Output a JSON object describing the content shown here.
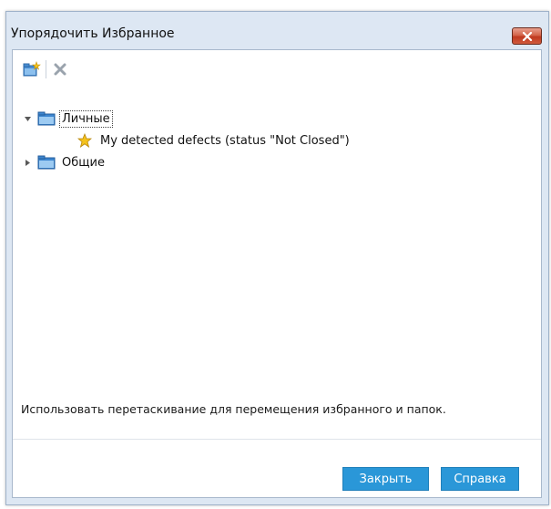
{
  "window": {
    "title": "Упорядочить Избранное",
    "close_icon": "close-icon"
  },
  "toolbar": {
    "new_folder_icon": "new-folder-icon",
    "delete_icon": "delete-icon"
  },
  "tree": {
    "items": [
      {
        "label": "Личные",
        "icon": "folder-icon",
        "expanded": true,
        "selected": true
      },
      {
        "label": "My detected defects (status \"Not Closed\")",
        "icon": "star-icon"
      },
      {
        "label": "Общие",
        "icon": "folder-icon",
        "expanded": false
      }
    ]
  },
  "hint": "Использовать перетаскивание для перемещения избранного и папок.",
  "buttons": {
    "close_label": "Закрыть",
    "help_label": "Справка"
  },
  "colors": {
    "accent": "#2a97d8",
    "frame": "#dde7f3",
    "close_button": "#c0391f"
  }
}
